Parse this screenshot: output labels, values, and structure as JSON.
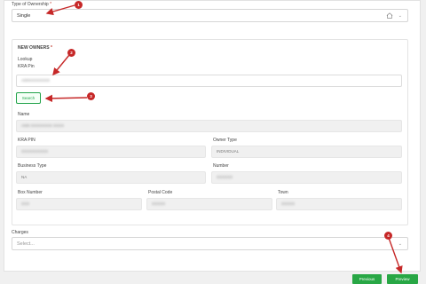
{
  "ownership": {
    "label": "Type of Ownership",
    "required_mark": "*",
    "value": "Single"
  },
  "new_owners": {
    "title": "NEW OWNERS",
    "required_mark": "*",
    "lookup_label": "Lookup",
    "kra_label": "KRA Pin",
    "kra_value": "A00XXXXXXXX",
    "search_label": "Search",
    "name_label": "Name",
    "name_value": "ANN XXXXXXXX XXXX",
    "kra_pin_label": "KRA PIN",
    "kra_pin_value": "XXXXXXXXXX",
    "owner_type_label": "Owner Type",
    "owner_type_value": "INDIVIDUAL",
    "business_type_label": "Business Type",
    "business_type_value": "NA",
    "number_label": "Number",
    "number_value": "XXXXXX",
    "box_number_label": "Box Number",
    "box_number_value": "XXX",
    "postal_code_label": "Postal Code",
    "postal_code_value": "XXXXX",
    "town_label": "Town",
    "town_value": "XXXXX"
  },
  "charges": {
    "label": "Charges",
    "placeholder": "Select..."
  },
  "footer": {
    "previous_label": "Previous",
    "preview_label": "Preview"
  },
  "annotations": [
    "1",
    "2",
    "3",
    "4"
  ],
  "colors": {
    "accent": "#28a745",
    "annotation": "#c62828"
  }
}
